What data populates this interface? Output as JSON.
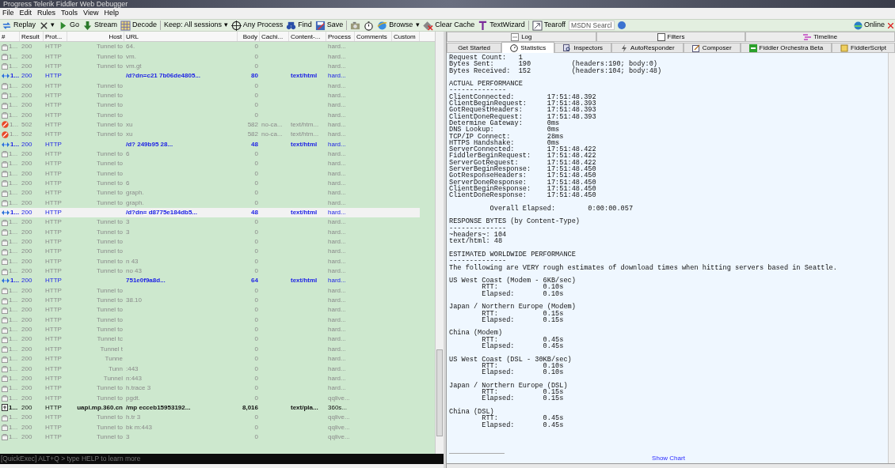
{
  "window": {
    "title": "Progress Telerik Fiddler Web Debugger"
  },
  "menu": [
    "File",
    "Edit",
    "Rules",
    "Tools",
    "View",
    "Help"
  ],
  "toolbar": [
    {
      "kind": "replay",
      "label": "Replay"
    },
    {
      "kind": "remove",
      "label": "▾"
    },
    {
      "kind": "go",
      "label": "Go"
    },
    {
      "kind": "stream",
      "label": "Stream"
    },
    {
      "kind": "decode",
      "label": "Decode"
    },
    {
      "kind": "sep"
    },
    {
      "kind": "text",
      "label": "Keep: All sessions ▾"
    },
    {
      "kind": "target",
      "label": "Any Process"
    },
    {
      "kind": "find",
      "label": "Find"
    },
    {
      "kind": "save",
      "label": "Save"
    },
    {
      "kind": "sep"
    },
    {
      "kind": "camera"
    },
    {
      "kind": "timer"
    },
    {
      "kind": "browse",
      "label": "Browse"
    },
    {
      "kind": "text",
      "label": "▾"
    },
    {
      "kind": "clear",
      "label": "Clear Cache"
    },
    {
      "kind": "wizard",
      "label": "TextWizard"
    },
    {
      "kind": "sep"
    },
    {
      "kind": "tearoff",
      "label": "Tearoff"
    }
  ],
  "search": {
    "placeholder": "MSDN Searcl"
  },
  "online": "Online",
  "columns": [
    "#",
    "Result",
    "Prot...",
    "Host",
    "URL",
    "Body",
    "Cachi...",
    "Content-...",
    "Process",
    "Comments",
    "Custom"
  ],
  "rows": [
    {
      "kind": "tunnel",
      "num": "1...",
      "result": "200",
      "protocol": "HTTP",
      "host": "Tunnel to",
      "url": "64.",
      "body": "0",
      "process": "hard...",
      "selected": false
    },
    {
      "kind": "tunnel",
      "num": "1...",
      "result": "200",
      "protocol": "HTTP",
      "host": "Tunnel to",
      "url": "vm.",
      "body": "0",
      "process": "hard...",
      "selected": false
    },
    {
      "kind": "tunnel",
      "num": "1...",
      "result": "200",
      "protocol": "HTTP",
      "host": "Tunnel to",
      "url": "vm.gt",
      "body": "0",
      "process": "hard...",
      "selected": false
    },
    {
      "kind": "web",
      "num": "1...",
      "result": "200",
      "protocol": "HTTP",
      "url": "/d?dn=c21 7b06de4805...",
      "body": "80",
      "content_type": "text/html",
      "process": "hard...",
      "selected": false
    },
    {
      "kind": "tunnel",
      "num": "1...",
      "result": "200",
      "protocol": "HTTP",
      "host": "Tunnel to",
      "body": "0",
      "process": "hard...",
      "selected": false
    },
    {
      "kind": "tunnel",
      "num": "1...",
      "result": "200",
      "protocol": "HTTP",
      "host": "Tunnel to",
      "body": "0",
      "process": "hard...",
      "selected": false
    },
    {
      "kind": "tunnel",
      "num": "1...",
      "result": "200",
      "protocol": "HTTP",
      "host": "Tunnel to",
      "body": "0",
      "process": "hard...",
      "selected": false
    },
    {
      "kind": "tunnel",
      "num": "1...",
      "result": "200",
      "protocol": "HTTP",
      "host": "Tunnel to",
      "body": "0",
      "process": "hard...",
      "selected": false
    },
    {
      "kind": "error",
      "num": "1...",
      "result": "502",
      "protocol": "HTTP",
      "host": "Tunnel to",
      "url": "xu",
      "body": "582",
      "caching": "no-ca...",
      "content_type": "text/htm...",
      "process": "hard...",
      "selected": false
    },
    {
      "kind": "error",
      "num": "1...",
      "result": "502",
      "protocol": "HTTP",
      "host": "Tunnel to",
      "url": "xu",
      "body": "582",
      "caching": "no-ca...",
      "content_type": "text/htm...",
      "process": "hard...",
      "selected": false
    },
    {
      "kind": "web",
      "num": "1...",
      "result": "200",
      "protocol": "HTTP",
      "url": "/d? 249b95 28...",
      "body": "48",
      "content_type": "text/html",
      "process": "hard...",
      "selected": false
    },
    {
      "kind": "tunnel",
      "num": "1...",
      "result": "200",
      "protocol": "HTTP",
      "host": "Tunnel to",
      "url": "6",
      "body": "0",
      "process": "hard...",
      "selected": false
    },
    {
      "kind": "tunnel",
      "num": "1...",
      "result": "200",
      "protocol": "HTTP",
      "host": "Tunnel to",
      "body": "0",
      "process": "hard...",
      "selected": false
    },
    {
      "kind": "tunnel",
      "num": "1...",
      "result": "200",
      "protocol": "HTTP",
      "host": "Tunnel to",
      "body": "0",
      "process": "hard...",
      "selected": false
    },
    {
      "kind": "tunnel",
      "num": "1...",
      "result": "200",
      "protocol": "HTTP",
      "host": "Tunnel to",
      "url": "6",
      "body": "0",
      "process": "hard...",
      "selected": false
    },
    {
      "kind": "tunnel",
      "num": "1...",
      "result": "200",
      "protocol": "HTTP",
      "host": "Tunnel to",
      "url": "graph.",
      "body": "0",
      "process": "hard...",
      "selected": false
    },
    {
      "kind": "tunnel",
      "num": "1...",
      "result": "200",
      "protocol": "HTTP",
      "host": "Tunnel to",
      "url": "graph.",
      "body": "0",
      "process": "hard...",
      "selected": false
    },
    {
      "kind": "web",
      "num": "1...",
      "result": "200",
      "protocol": "HTTP",
      "url": "/d?dn= d8775e184db5...",
      "body": "48",
      "content_type": "text/html",
      "process": "hard...",
      "selected": true
    },
    {
      "kind": "tunnel",
      "num": "1...",
      "result": "200",
      "protocol": "HTTP",
      "host": "Tunnel to",
      "url": "3",
      "body": "0",
      "process": "hard...",
      "selected": false
    },
    {
      "kind": "tunnel",
      "num": "1...",
      "result": "200",
      "protocol": "HTTP",
      "host": "Tunnel to",
      "url": "3",
      "body": "0",
      "process": "hard...",
      "selected": false
    },
    {
      "kind": "tunnel",
      "num": "1...",
      "result": "200",
      "protocol": "HTTP",
      "host": "Tunnel to",
      "body": "0",
      "process": "hard...",
      "selected": false
    },
    {
      "kind": "tunnel",
      "num": "1...",
      "result": "200",
      "protocol": "HTTP",
      "host": "Tunnel to",
      "body": "0",
      "process": "hard...",
      "selected": false
    },
    {
      "kind": "tunnel",
      "num": "1...",
      "result": "200",
      "protocol": "HTTP",
      "host": "Tunnel to",
      "url": "n 43",
      "body": "0",
      "process": "hard...",
      "selected": false
    },
    {
      "kind": "tunnel",
      "num": "1...",
      "result": "200",
      "protocol": "HTTP",
      "host": "Tunnel to",
      "url": "no 43",
      "body": "0",
      "process": "hard...",
      "selected": false
    },
    {
      "kind": "web",
      "num": "1...",
      "result": "200",
      "protocol": "HTTP",
      "url": "751e0f9a8d...",
      "body": "64",
      "content_type": "text/html",
      "process": "hard...",
      "selected": false
    },
    {
      "kind": "tunnel",
      "num": "1...",
      "result": "200",
      "protocol": "HTTP",
      "host": "Tunnel to",
      "body": "0",
      "process": "hard...",
      "selected": false
    },
    {
      "kind": "tunnel",
      "num": "1...",
      "result": "200",
      "protocol": "HTTP",
      "host": "Tunnel to",
      "url": "38.10",
      "body": "0",
      "process": "hard...",
      "selected": false
    },
    {
      "kind": "tunnel",
      "num": "1...",
      "result": "200",
      "protocol": "HTTP",
      "host": "Tunnel to",
      "body": "0",
      "process": "hard...",
      "selected": false
    },
    {
      "kind": "tunnel",
      "num": "1...",
      "result": "200",
      "protocol": "HTTP",
      "host": "Tunnel to",
      "body": "0",
      "process": "hard...",
      "selected": false
    },
    {
      "kind": "tunnel",
      "num": "1...",
      "result": "200",
      "protocol": "HTTP",
      "host": "Tunnel to",
      "body": "0",
      "process": "hard...",
      "selected": false
    },
    {
      "kind": "tunnel",
      "num": "1...",
      "result": "200",
      "protocol": "HTTP",
      "host": "Tunnel tc",
      "body": "0",
      "process": "hard...",
      "selected": false
    },
    {
      "kind": "tunnel",
      "num": "1...",
      "result": "200",
      "protocol": "HTTP",
      "host": "Tunnel t",
      "body": "0",
      "process": "hard...",
      "selected": false
    },
    {
      "kind": "tunnel",
      "num": "1...",
      "result": "200",
      "protocol": "HTTP",
      "host": "Tunne",
      "body": "0",
      "process": "hard...",
      "selected": false
    },
    {
      "kind": "tunnel",
      "num": "1...",
      "result": "200",
      "protocol": "HTTP",
      "host": "Tunn",
      "url": ":443",
      "body": "0",
      "process": "hard...",
      "selected": false
    },
    {
      "kind": "tunnel",
      "num": "1...",
      "result": "200",
      "protocol": "HTTP",
      "host": "Tunnel",
      "url": "n:443",
      "body": "0",
      "process": "hard...",
      "selected": false
    },
    {
      "kind": "tunnel",
      "num": "1...",
      "result": "200",
      "protocol": "HTTP",
      "host": "Tunnel to",
      "url": "h.trace 3",
      "body": "0",
      "process": "hard...",
      "selected": false
    },
    {
      "kind": "tunnel",
      "num": "1...",
      "result": "200",
      "protocol": "HTTP",
      "host": "Tunnel to",
      "url": "pgdt.",
      "body": "0",
      "process": "qqlive...",
      "selected": false
    },
    {
      "kind": "script",
      "num": "1...",
      "result": "200",
      "protocol": "HTTP",
      "host": "uapi.mp.360.cn",
      "url": "/mp ecceb15953192...",
      "body": "8,016",
      "content_type": "text/pla...",
      "process": "360s...",
      "selected": false
    },
    {
      "kind": "tunnel",
      "num": "1...",
      "result": "200",
      "protocol": "HTTP",
      "host": "Tunnel to",
      "url": "h.tr 3",
      "body": "0",
      "process": "qqlive...",
      "selected": false
    },
    {
      "kind": "tunnel",
      "num": "1...",
      "result": "200",
      "protocol": "HTTP",
      "host": "Tunnel to",
      "url": "bk m:443",
      "body": "0",
      "process": "qqlive...",
      "selected": false
    },
    {
      "kind": "tunnel",
      "num": "1...",
      "result": "200",
      "protocol": "HTTP",
      "host": "Tunnel to",
      "url": "3",
      "body": "0",
      "process": "qqlive...",
      "selected": false
    }
  ],
  "quickexec": "[QuickExec] ALT+Q > type HELP to learn more",
  "top_tabs": [
    {
      "kind": "log",
      "label": "Log"
    },
    {
      "kind": "filters",
      "label": "Filters"
    },
    {
      "kind": "timeline",
      "label": "Timeline"
    }
  ],
  "tabs": [
    {
      "kind": "none",
      "label": "Get Started",
      "selected": false
    },
    {
      "kind": "stats",
      "label": "Statistics",
      "selected": true
    },
    {
      "kind": "inspect",
      "label": "Inspectors",
      "selected": false
    },
    {
      "kind": "bolt",
      "label": "AutoResponder",
      "selected": false
    },
    {
      "kind": "compose",
      "label": "Composer",
      "selected": false
    },
    {
      "kind": "fo",
      "label": "Fiddler Orchestra Beta",
      "selected": false
    },
    {
      "kind": "script",
      "label": "FiddlerScript",
      "selected": false
    }
  ],
  "statistics": [
    [
      "Request Count:   1",
      "Bytes Sent:      190          (headers:190; body:0)",
      "Bytes Received:  152          (headers:104; body:48)"
    ],
    [
      "ACTUAL PERFORMANCE",
      "--------------",
      "ClientConnected:        17:51:48.392",
      "ClientBeginRequest:     17:51:48.393",
      "GotRequestHeaders:      17:51:48.393",
      "ClientDoneRequest:      17:51:48.393",
      "Determine Gateway:      0ms",
      "DNS Lookup:             0ms",
      "TCP/IP Connect:         28ms",
      "HTTPS Handshake:        0ms",
      "ServerConnected:        17:51:48.422",
      "FiddlerBeginRequest:    17:51:48.422",
      "ServerGotRequest:       17:51:48.422",
      "ServerBeginResponse:    17:51:48.450",
      "GotResponseHeaders:     17:51:48.450",
      "ServerDoneResponse:     17:51:48.450",
      "ClientBeginResponse:    17:51:48.450",
      "ClientDoneResponse:     17:51:48.450"
    ],
    [
      "          Overall Elapsed:        0:00:00.057"
    ],
    [
      "RESPONSE BYTES (by Content-Type)",
      "--------------",
      "~headers~: 104",
      "text/html: 48"
    ],
    [
      "ESTIMATED WORLDWIDE PERFORMANCE",
      "--------------",
      "The following are VERY rough estimates of download times when hitting servers based in Seattle."
    ],
    [
      "US West Coast (Modem - 6KB/sec)",
      "        RTT:           0.10s",
      "        Elapsed:       0.10s"
    ],
    [
      "Japan / Northern Europe (Modem)",
      "        RTT:           0.15s",
      "        Elapsed:       0.15s"
    ],
    [
      "China (Modem)",
      "        RTT:           0.45s",
      "        Elapsed:       0.45s"
    ],
    [
      "US West Coast (DSL - 30KB/sec)",
      "        RTT:           0.10s",
      "        Elapsed:       0.10s"
    ],
    [
      "Japan / Northern Europe (DSL)",
      "        RTT:           0.15s",
      "        Elapsed:       0.15s"
    ],
    [
      "China (DSL)",
      "        RTT:           0.45s",
      "        Elapsed:       0.45s"
    ]
  ],
  "show_chart": "Show Chart"
}
